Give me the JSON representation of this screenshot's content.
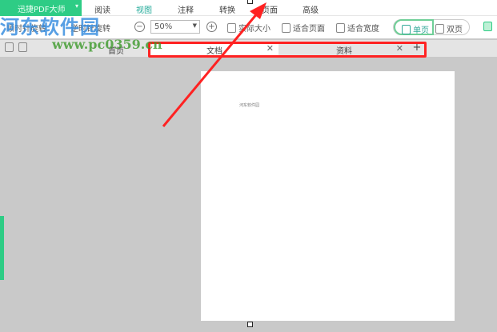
{
  "app": {
    "name": "迅捷PDF大师"
  },
  "menu": [
    "阅读",
    "视图",
    "注释",
    "转换",
    "页面",
    "高级"
  ],
  "toolbar": {
    "rotate_cw": "顺时针旋转",
    "rotate_ccw": "逆时针旋转",
    "zoom": "50%",
    "actual_size": "实际大小",
    "fit_page": "适合页面",
    "fit_width": "适合宽度",
    "single": "单页",
    "double": "双页"
  },
  "tabs": {
    "home": "首页",
    "items": [
      {
        "label": "文档"
      },
      {
        "label": "资料"
      }
    ],
    "add": "+",
    "close": "✕"
  },
  "document": {
    "text": "河东软件园"
  },
  "watermark": {
    "title": "河东软件园",
    "url": "www.pc0359.cn"
  },
  "colors": {
    "accent": "#2ecc85",
    "annotation": "#ff2222"
  }
}
